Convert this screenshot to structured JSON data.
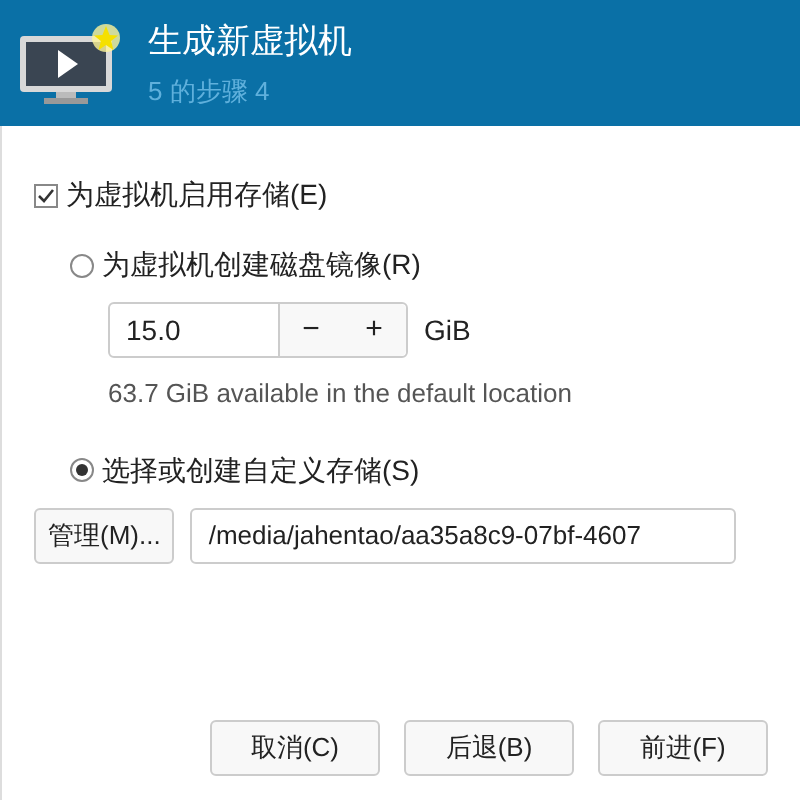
{
  "header": {
    "title": "生成新虚拟机",
    "subtitle": "5 的步骤 4"
  },
  "enable_storage": {
    "label": "为虚拟机启用存储(E)",
    "checked": true
  },
  "options": [
    {
      "kind": "disk",
      "label": "为虚拟机创建磁盘镜像(R)",
      "selected": false,
      "size": "15.0",
      "minus": "−",
      "plus": "+",
      "unit": "GiB",
      "note": "63.7 GiB available in the default location"
    },
    {
      "kind": "custom",
      "label": "选择或创建自定义存储(S)",
      "selected": true,
      "button": "管理(M)...",
      "path": "/media/jahentao/aa35a8c9-07bf-4607"
    }
  ],
  "buttons": [
    "取消(C)",
    "后退(B)",
    "前进(F)"
  ]
}
